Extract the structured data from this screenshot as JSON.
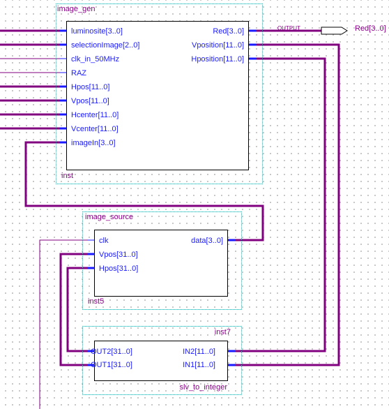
{
  "image_gen": {
    "title": "image_gen",
    "instance": "inst",
    "inputs": [
      "luminosite[3..0]",
      "selectionImage[2..0]",
      "clk_in_50MHz",
      "RAZ",
      "Hpos[11..0]",
      "Vpos[11..0]",
      "Hcenter[11..0]",
      "Vcenter[11..0]",
      "imageIn[3..0]"
    ],
    "outputs": [
      "Red[3..0]",
      "Vposition[11..0]",
      "Hposition[11..0]"
    ]
  },
  "image_source": {
    "title": "image_source",
    "instance": "inst5",
    "inputs": [
      "clk",
      "Vpos[31..0]",
      "Hpos[31..0]"
    ],
    "outputs": [
      "data[3..0]"
    ]
  },
  "slv_to_integer": {
    "title": "slv_to_integer",
    "instance": "inst7",
    "outputs": [
      "OUT2[31..0]",
      "OUT1[31..0]"
    ],
    "inputs": [
      "IN2[11..0]",
      "IN1[11..0]"
    ]
  },
  "output_pin": {
    "type_label": "OUTPUT",
    "name": "Red[3..0]"
  },
  "colors": {
    "bus": "#800080",
    "net": "#800080",
    "port_text": "#1a1aff",
    "instance_text": "#8b008b",
    "frame": "#2aa6a6"
  }
}
